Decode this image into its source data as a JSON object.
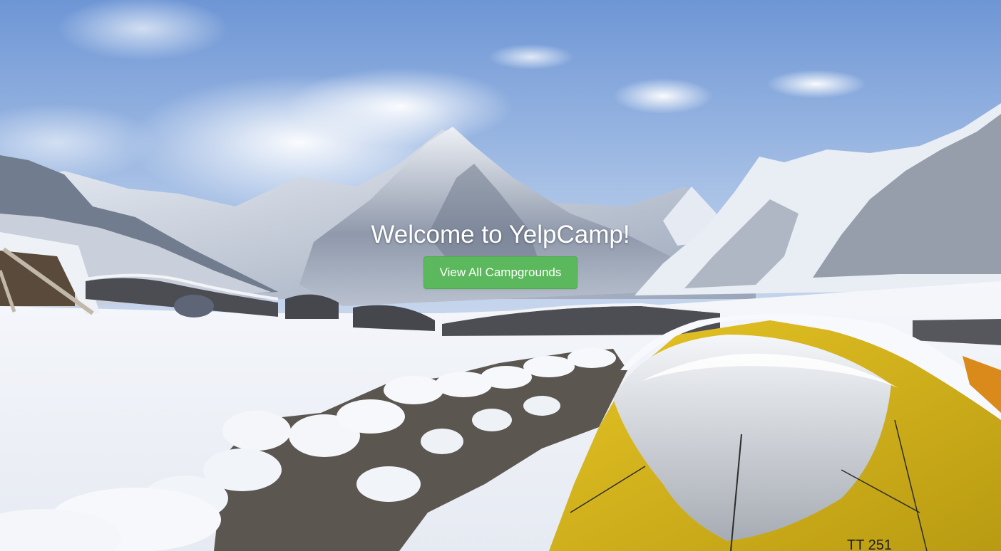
{
  "hero": {
    "title": "Welcome to YelpCamp!",
    "button_label": "View All Campgrounds"
  },
  "background": {
    "description_icon": "snowy-mountain-campsite-photo",
    "tent_tag_text": "TT 251"
  },
  "colors": {
    "button_bg": "#5cb85c",
    "button_border": "#4cae4c",
    "title_text": "#ffffff"
  }
}
